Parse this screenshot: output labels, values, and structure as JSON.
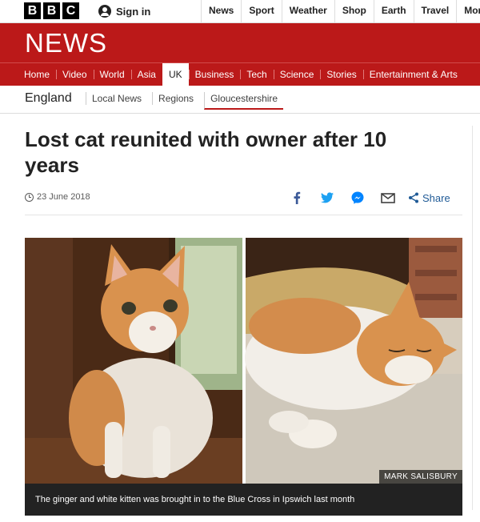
{
  "bbc_letters": [
    "B",
    "B",
    "C"
  ],
  "signin_label": "Sign in",
  "top_nav": [
    "News",
    "Sport",
    "Weather",
    "Shop",
    "Earth",
    "Travel",
    "More"
  ],
  "header_title": "NEWS",
  "section_nav": [
    {
      "label": "Home",
      "active": false
    },
    {
      "label": "Video",
      "active": false
    },
    {
      "label": "World",
      "active": false
    },
    {
      "label": "Asia",
      "active": false
    },
    {
      "label": "UK",
      "active": true
    },
    {
      "label": "Business",
      "active": false
    },
    {
      "label": "Tech",
      "active": false
    },
    {
      "label": "Science",
      "active": false
    },
    {
      "label": "Stories",
      "active": false
    },
    {
      "label": "Entertainment & Arts",
      "active": false
    }
  ],
  "sub_nav": {
    "region": "England",
    "links": [
      "Local News",
      "Regions",
      "Gloucestershire"
    ],
    "current": "Gloucestershire"
  },
  "article": {
    "headline": "Lost cat reunited with owner after 10 years",
    "date": "23 June 2018",
    "share_label": "Share",
    "share_icons": [
      "facebook-icon",
      "twitter-icon",
      "messenger-icon",
      "email-icon",
      "share-icon"
    ],
    "image_credit": "MARK SALISBURY",
    "image_caption": "The ginger and white kitten was brought in to the Blue Cross in Ipswich last month"
  },
  "colors": {
    "brand_red": "#bb1919",
    "link_blue": "#1f5a96",
    "caption_bg": "#222222"
  }
}
